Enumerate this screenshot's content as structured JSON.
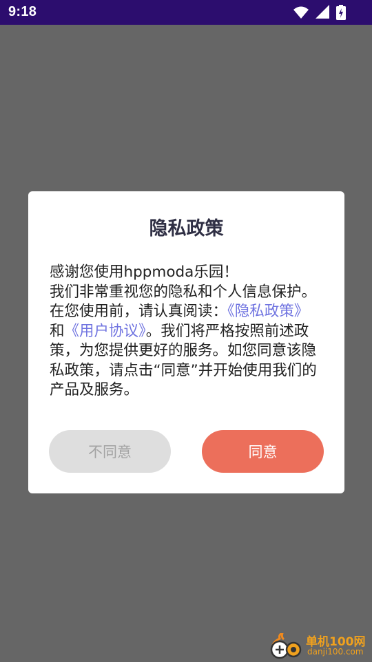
{
  "status_bar": {
    "time": "9:18",
    "icons": [
      "wifi-icon",
      "signal-icon",
      "battery-charging-icon"
    ],
    "color": "#2c0d6e"
  },
  "dialog": {
    "title": "隐私政策",
    "greeting": "感谢您使用hppmoda乐园！",
    "body_part1": "我们非常重视您的隐私和个人信息保护。在您使用前，请认真阅读：",
    "privacy_link": "《隐私政策》",
    "connector": "和",
    "agreement_link": "《用户协议》",
    "body_part2": "。我们将严格按照前述政策，为您提供更好的服务。如您同意该隐私政策，请点击“同意”并开始使用我们的产品及服务。",
    "disagree_label": "不同意",
    "agree_label": "同意",
    "link_color": "#6f73e0",
    "agree_color": "#ec6f5b"
  },
  "watermark": {
    "name": "单机100网",
    "url": "danji100.com"
  }
}
